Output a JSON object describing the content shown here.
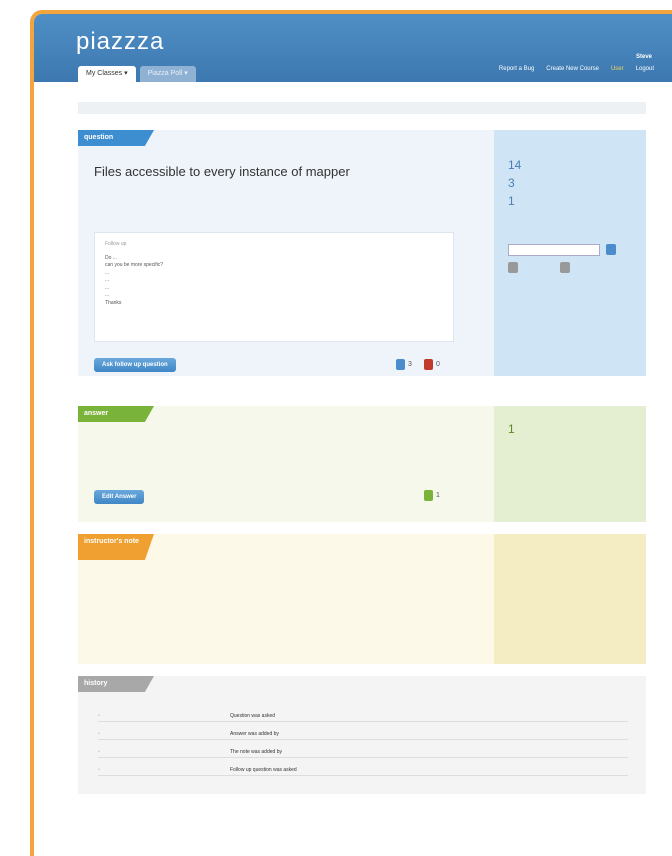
{
  "header": {
    "logo": "piazzza",
    "tagline": "",
    "tabs": [
      {
        "label": "My Classes  ▾"
      },
      {
        "label": "Piazza Poll  ▾"
      }
    ],
    "user": "Steve",
    "nav": [
      {
        "label": "Report a Bug"
      },
      {
        "label": "Create New Course"
      },
      {
        "label": "User"
      },
      {
        "label": "Logout"
      }
    ]
  },
  "breadcrumb": "",
  "question": {
    "tag": "question",
    "title": "Files accessible to every instance of mapper",
    "body": "",
    "followup": {
      "title": "Follow up",
      "lines": [
        "Do ...",
        "can you be more specific?",
        "",
        "...",
        "...",
        "...",
        "...",
        "Thanks"
      ],
      "meta": ""
    },
    "button": "Ask follow up question",
    "comments": "3",
    "bookmarks": "0",
    "stats": [
      {
        "num": "14",
        "label": ""
      },
      {
        "num": "3",
        "label": ""
      },
      {
        "num": "1",
        "label": ""
      }
    ],
    "side_note": "",
    "btn_save": "",
    "btn_add": "",
    "btn_edit": ""
  },
  "answer": {
    "tag": "answer",
    "body1": "",
    "body2": "",
    "button": "Edit Answer",
    "comments": "1",
    "stat_num": "1",
    "stat_label": "",
    "stat_sub": "",
    "side_note": ""
  },
  "note": {
    "tag": "instructor's note",
    "body": "",
    "side_lines": [
      "",
      ""
    ],
    "side_author": ""
  },
  "history": {
    "tag": "history",
    "rows": [
      {
        "date": "",
        "what": "Question was asked",
        "who": ""
      },
      {
        "date": "",
        "what": "Answer was added by",
        "who": ""
      },
      {
        "date": "",
        "what": "The note was added by",
        "who": ""
      },
      {
        "date": "",
        "what": "Follow up question was asked",
        "who": ""
      }
    ]
  },
  "footer": {
    "line1": "",
    "line2": ""
  },
  "colors": {
    "accent": "#3d8ed0",
    "answer": "#7ab33a",
    "instructor": "#f0a030",
    "frame": "#f3a43c"
  }
}
